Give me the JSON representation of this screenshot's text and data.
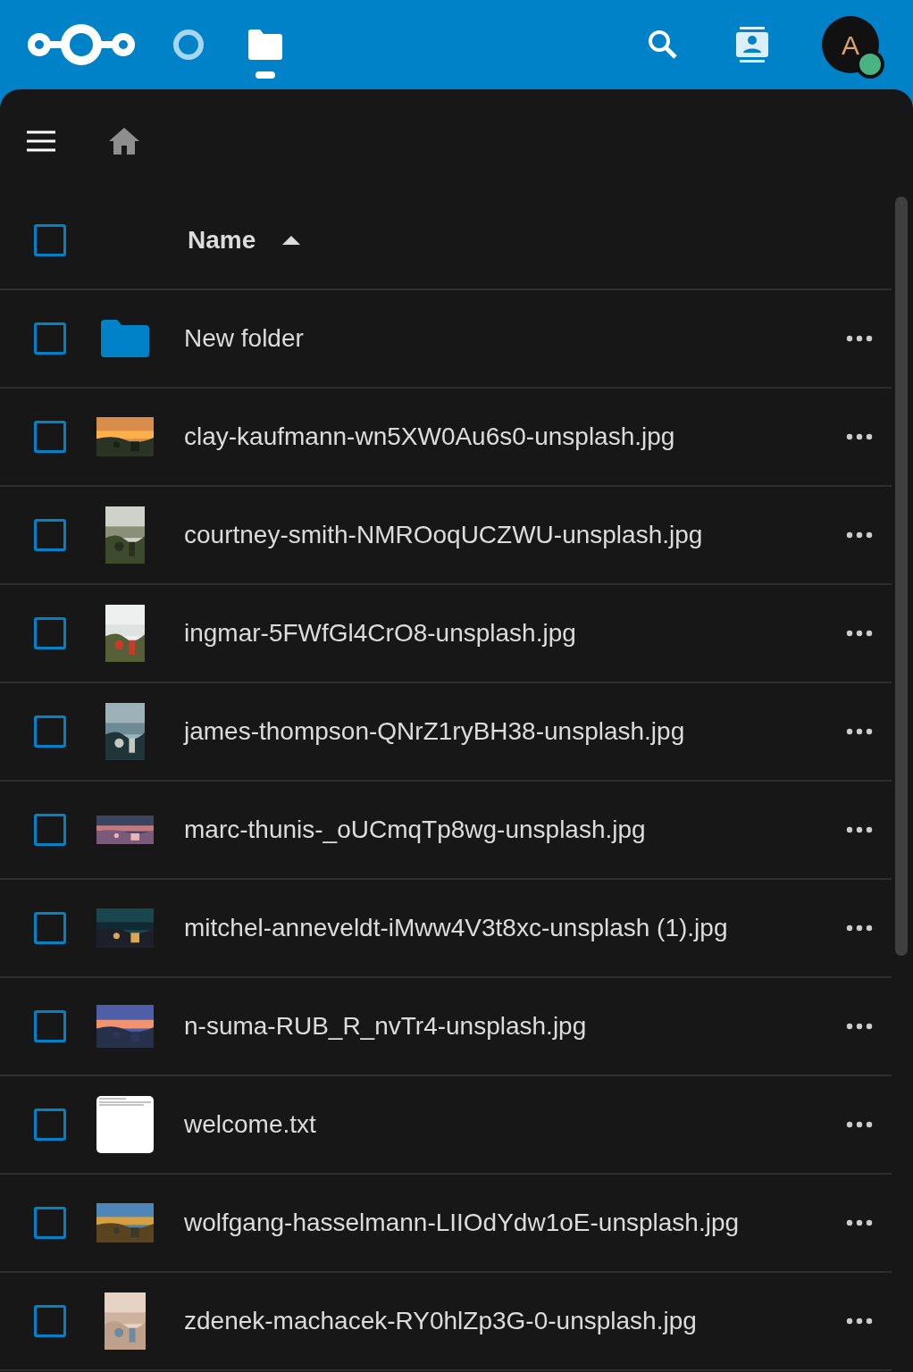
{
  "app_nav": [
    {
      "kind": "dashboard",
      "selected": false
    },
    {
      "kind": "files",
      "selected": true
    }
  ],
  "account": {
    "initial": "A",
    "online": true
  },
  "file_list": {
    "select_all": {
      "checked": false
    },
    "column": {
      "label": "Name",
      "sort_ascending": true
    },
    "rows": [
      {
        "kind": "folder",
        "name": "New folder",
        "checked": false
      },
      {
        "name": "clay-kaufmann-wn5XW0Au6s0-unsplash.jpg",
        "checked": false
      },
      {
        "name": "courtney-smith-NMROoqUCZWU-unsplash.jpg",
        "checked": false
      },
      {
        "name": "ingmar-5FWfGl4CrO8-unsplash.jpg",
        "checked": false
      },
      {
        "name": "james-thompson-QNrZ1ryBH38-unsplash.jpg",
        "checked": false
      },
      {
        "name": "marc-thunis-_oUCmqTp8wg-unsplash.jpg",
        "checked": false
      },
      {
        "name": "mitchel-anneveldt-iMww4V3t8xc-unsplash (1).jpg",
        "checked": false
      },
      {
        "name": "n-suma-RUB_R_nvTr4-unsplash.jpg",
        "checked": false
      },
      {
        "kind": "text",
        "name": "welcome.txt",
        "checked": false
      },
      {
        "name": "wolfgang-hasselmann-LIIOdYdw1oE-unsplash.jpg",
        "checked": false
      },
      {
        "name": "zdenek-machacek-RY0hlZp3G-0-unsplash.jpg",
        "checked": false
      }
    ]
  }
}
